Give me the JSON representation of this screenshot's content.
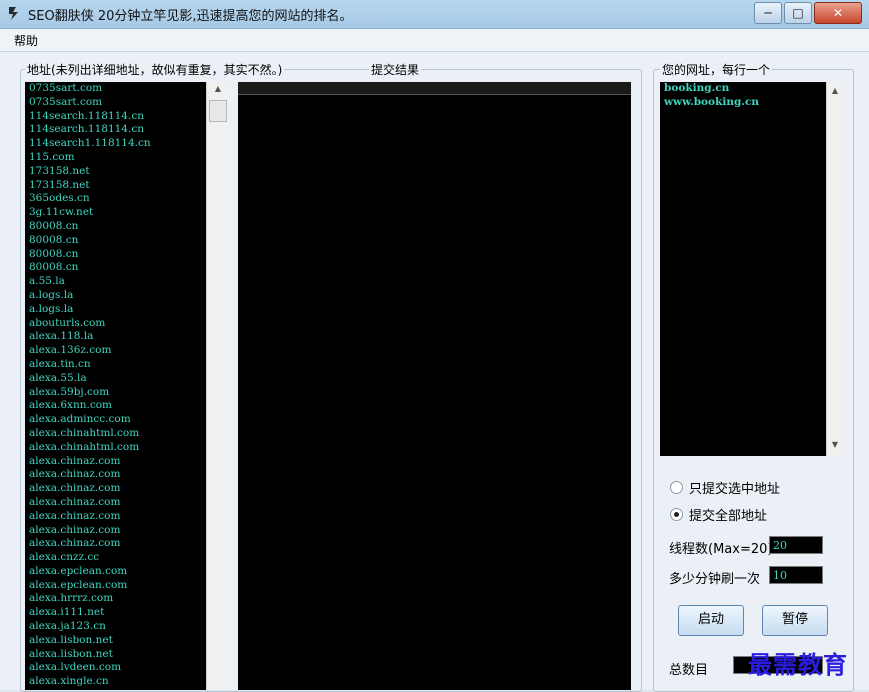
{
  "window": {
    "title": "SEO翻肤侠  20分钟立竿见影,迅速提高您的网站的排名。",
    "minimize_glyph": "─",
    "maximize_glyph": "□",
    "close_glyph": "✕"
  },
  "menu": {
    "help_label": "帮助"
  },
  "address_group": {
    "label": "地址(未列出详细地址，故似有重复，其实不然。)",
    "items": [
      "0735sart.com",
      "0735sart.com",
      "114search.118114.cn",
      "114search.118114.cn",
      "114search1.118114.cn",
      "115.com",
      "173158.net",
      "173158.net",
      "365odes.cn",
      "3g.11cw.net",
      "80008.cn",
      "80008.cn",
      "80008.cn",
      "80008.cn",
      "a.55.la",
      "a.logs.la",
      "a.logs.la",
      "abouturls.com",
      "alexa.118.la",
      "alexa.136z.com",
      "alexa.tin.cn",
      "alexa.55.la",
      "alexa.59bj.com",
      "alexa.6xnn.com",
      "alexa.admincc.com",
      "alexa.chinahtml.com",
      "alexa.chinahtml.com",
      "alexa.chinaz.com",
      "alexa.chinaz.com",
      "alexa.chinaz.com",
      "alexa.chinaz.com",
      "alexa.chinaz.com",
      "alexa.chinaz.com",
      "alexa.chinaz.com",
      "alexa.cnzz.cc",
      "alexa.epclean.com",
      "alexa.epclean.com",
      "alexa.hrrrz.com",
      "alexa.i111.net",
      "alexa.ja123.cn",
      "alexa.lisbon.net",
      "alexa.lisbon.net",
      "alexa.lvdeen.com",
      "alexa.xingle.cn"
    ]
  },
  "result_group": {
    "label": "提交结果"
  },
  "site_group": {
    "label": "您的网址，每行一个",
    "items": [
      "booking.cn",
      "www.booking.cn"
    ]
  },
  "options": {
    "radio_selected_label": "只提交选中地址",
    "radio_all_label": "提交全部地址",
    "thread_label": "线程数(Max=20)",
    "thread_value": "20",
    "interval_label": "多少分钟刷一次",
    "interval_value": "10"
  },
  "buttons": {
    "start_label": "启动",
    "pause_label": "暂停"
  },
  "stats": {
    "total_label": "总数目"
  },
  "watermark": "最需教育"
}
